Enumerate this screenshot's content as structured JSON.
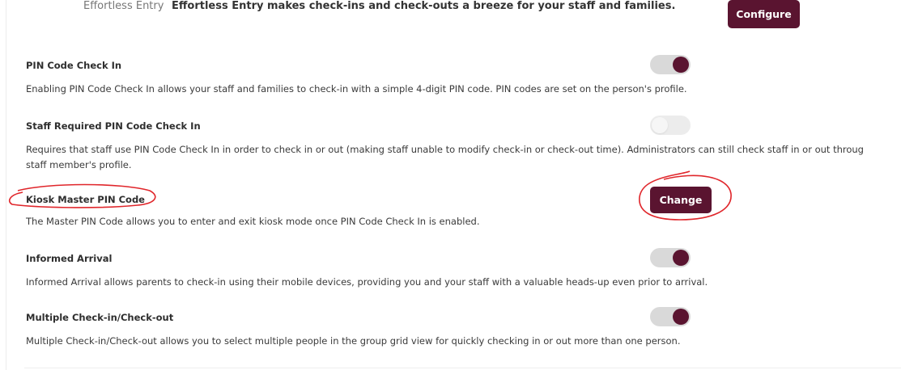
{
  "top_row": {
    "label": "Effortless Entry",
    "description": "Effortless Entry makes check-ins and check-outs a breeze for your staff and families.",
    "configure_label": "Configure"
  },
  "settings": [
    {
      "title": "PIN Code Check In",
      "description_lines": [
        "Enabling PIN Code Check In allows your staff and families to check-in with a simple 4-digit PIN code. PIN codes are set on the person's profile."
      ],
      "control": "toggle",
      "enabled": true
    },
    {
      "title": "Staff Required PIN Code Check In",
      "description_lines": [
        "Requires that staff use PIN Code Check In in order to check in or out (making staff unable to modify check-in or check-out time). Administrators can still check staff in or out throug",
        "staff member's profile."
      ],
      "control": "toggle",
      "enabled": false
    },
    {
      "title": "Kiosk Master PIN Code",
      "description_lines": [
        "The Master PIN Code allows you to enter and exit kiosk mode once PIN Code Check In is enabled."
      ],
      "control": "button",
      "button_label": "Change"
    },
    {
      "title": "Informed Arrival",
      "description_lines": [
        "Informed Arrival allows parents to check-in using their mobile devices, providing you and your staff with a valuable heads-up even prior to arrival."
      ],
      "control": "toggle",
      "enabled": true
    },
    {
      "title": "Multiple Check-in/Check-out",
      "description_lines": [
        "Multiple Check-in/Check-out allows you to select multiple people in the group grid view for quickly checking in or out more than one person."
      ],
      "control": "toggle",
      "enabled": true
    }
  ],
  "colors": {
    "brand": "#5a1430",
    "toggle_track": "#d9d9d9",
    "annotation": "#e0262b"
  }
}
